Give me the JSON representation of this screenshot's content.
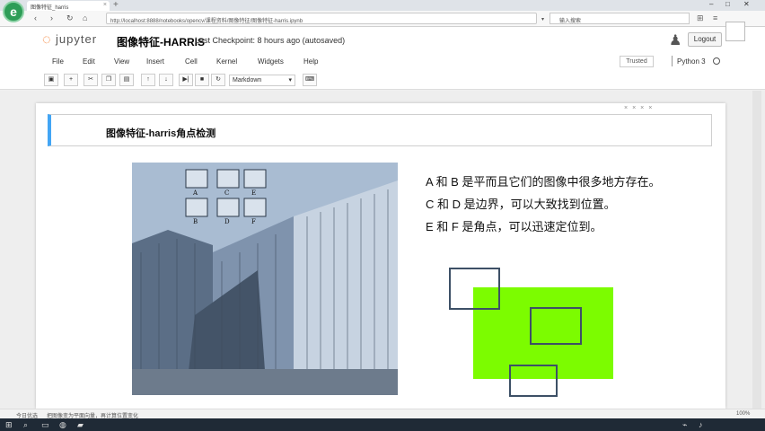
{
  "browser": {
    "tab_title": "图像特征_harris",
    "url": "http://localhost:8888/notebooks/opencv/课程资料/图像特征/图像特征-harris.ipynb",
    "search_placeholder": "输入搜索",
    "logo": "e"
  },
  "jupyter": {
    "logo_text": "jupyter",
    "notebook_title": "图像特征-HARRIS",
    "checkpoint": "Last Checkpoint: 8 hours ago (autosaved)",
    "logout": "Logout",
    "trusted": "Trusted",
    "kernel": "Python 3"
  },
  "menu": [
    "File",
    "Edit",
    "View",
    "Insert",
    "Cell",
    "Kernel",
    "Widgets",
    "Help"
  ],
  "toolbar": {
    "icons": [
      "save-icon",
      "plus-icon",
      "cut-icon",
      "copy-icon",
      "paste-icon",
      "up-icon",
      "down-icon",
      "run-icon",
      "stop-icon",
      "restart-icon"
    ],
    "glyphs": [
      "▣",
      "+",
      "✂",
      "❐",
      "▤",
      "↑",
      "↓",
      "▶|",
      "■",
      "↻"
    ],
    "cell_type": "Markdown",
    "keyboard_glyph": "⌨"
  },
  "cell": {
    "heading": "图像特征-harris角点检测"
  },
  "figure_labels": [
    "A",
    "C",
    "E",
    "B",
    "D",
    "F"
  ],
  "content": {
    "line1": "A 和 B 是平而且它们的图像中很多地方存在。",
    "line2": "C 和 D 是边界，可以大致找到位置。",
    "line3": "E 和 F 是角点，可以迅速定位到。"
  },
  "status": {
    "left": "今日优选",
    "mid": "把图像变为平面向量，再计算位置变化",
    "right": "100%"
  },
  "colors": {
    "green": "#7cfc00",
    "box": "#3d5066",
    "building": "#9fb3cc",
    "accent": "#42a5f5"
  }
}
